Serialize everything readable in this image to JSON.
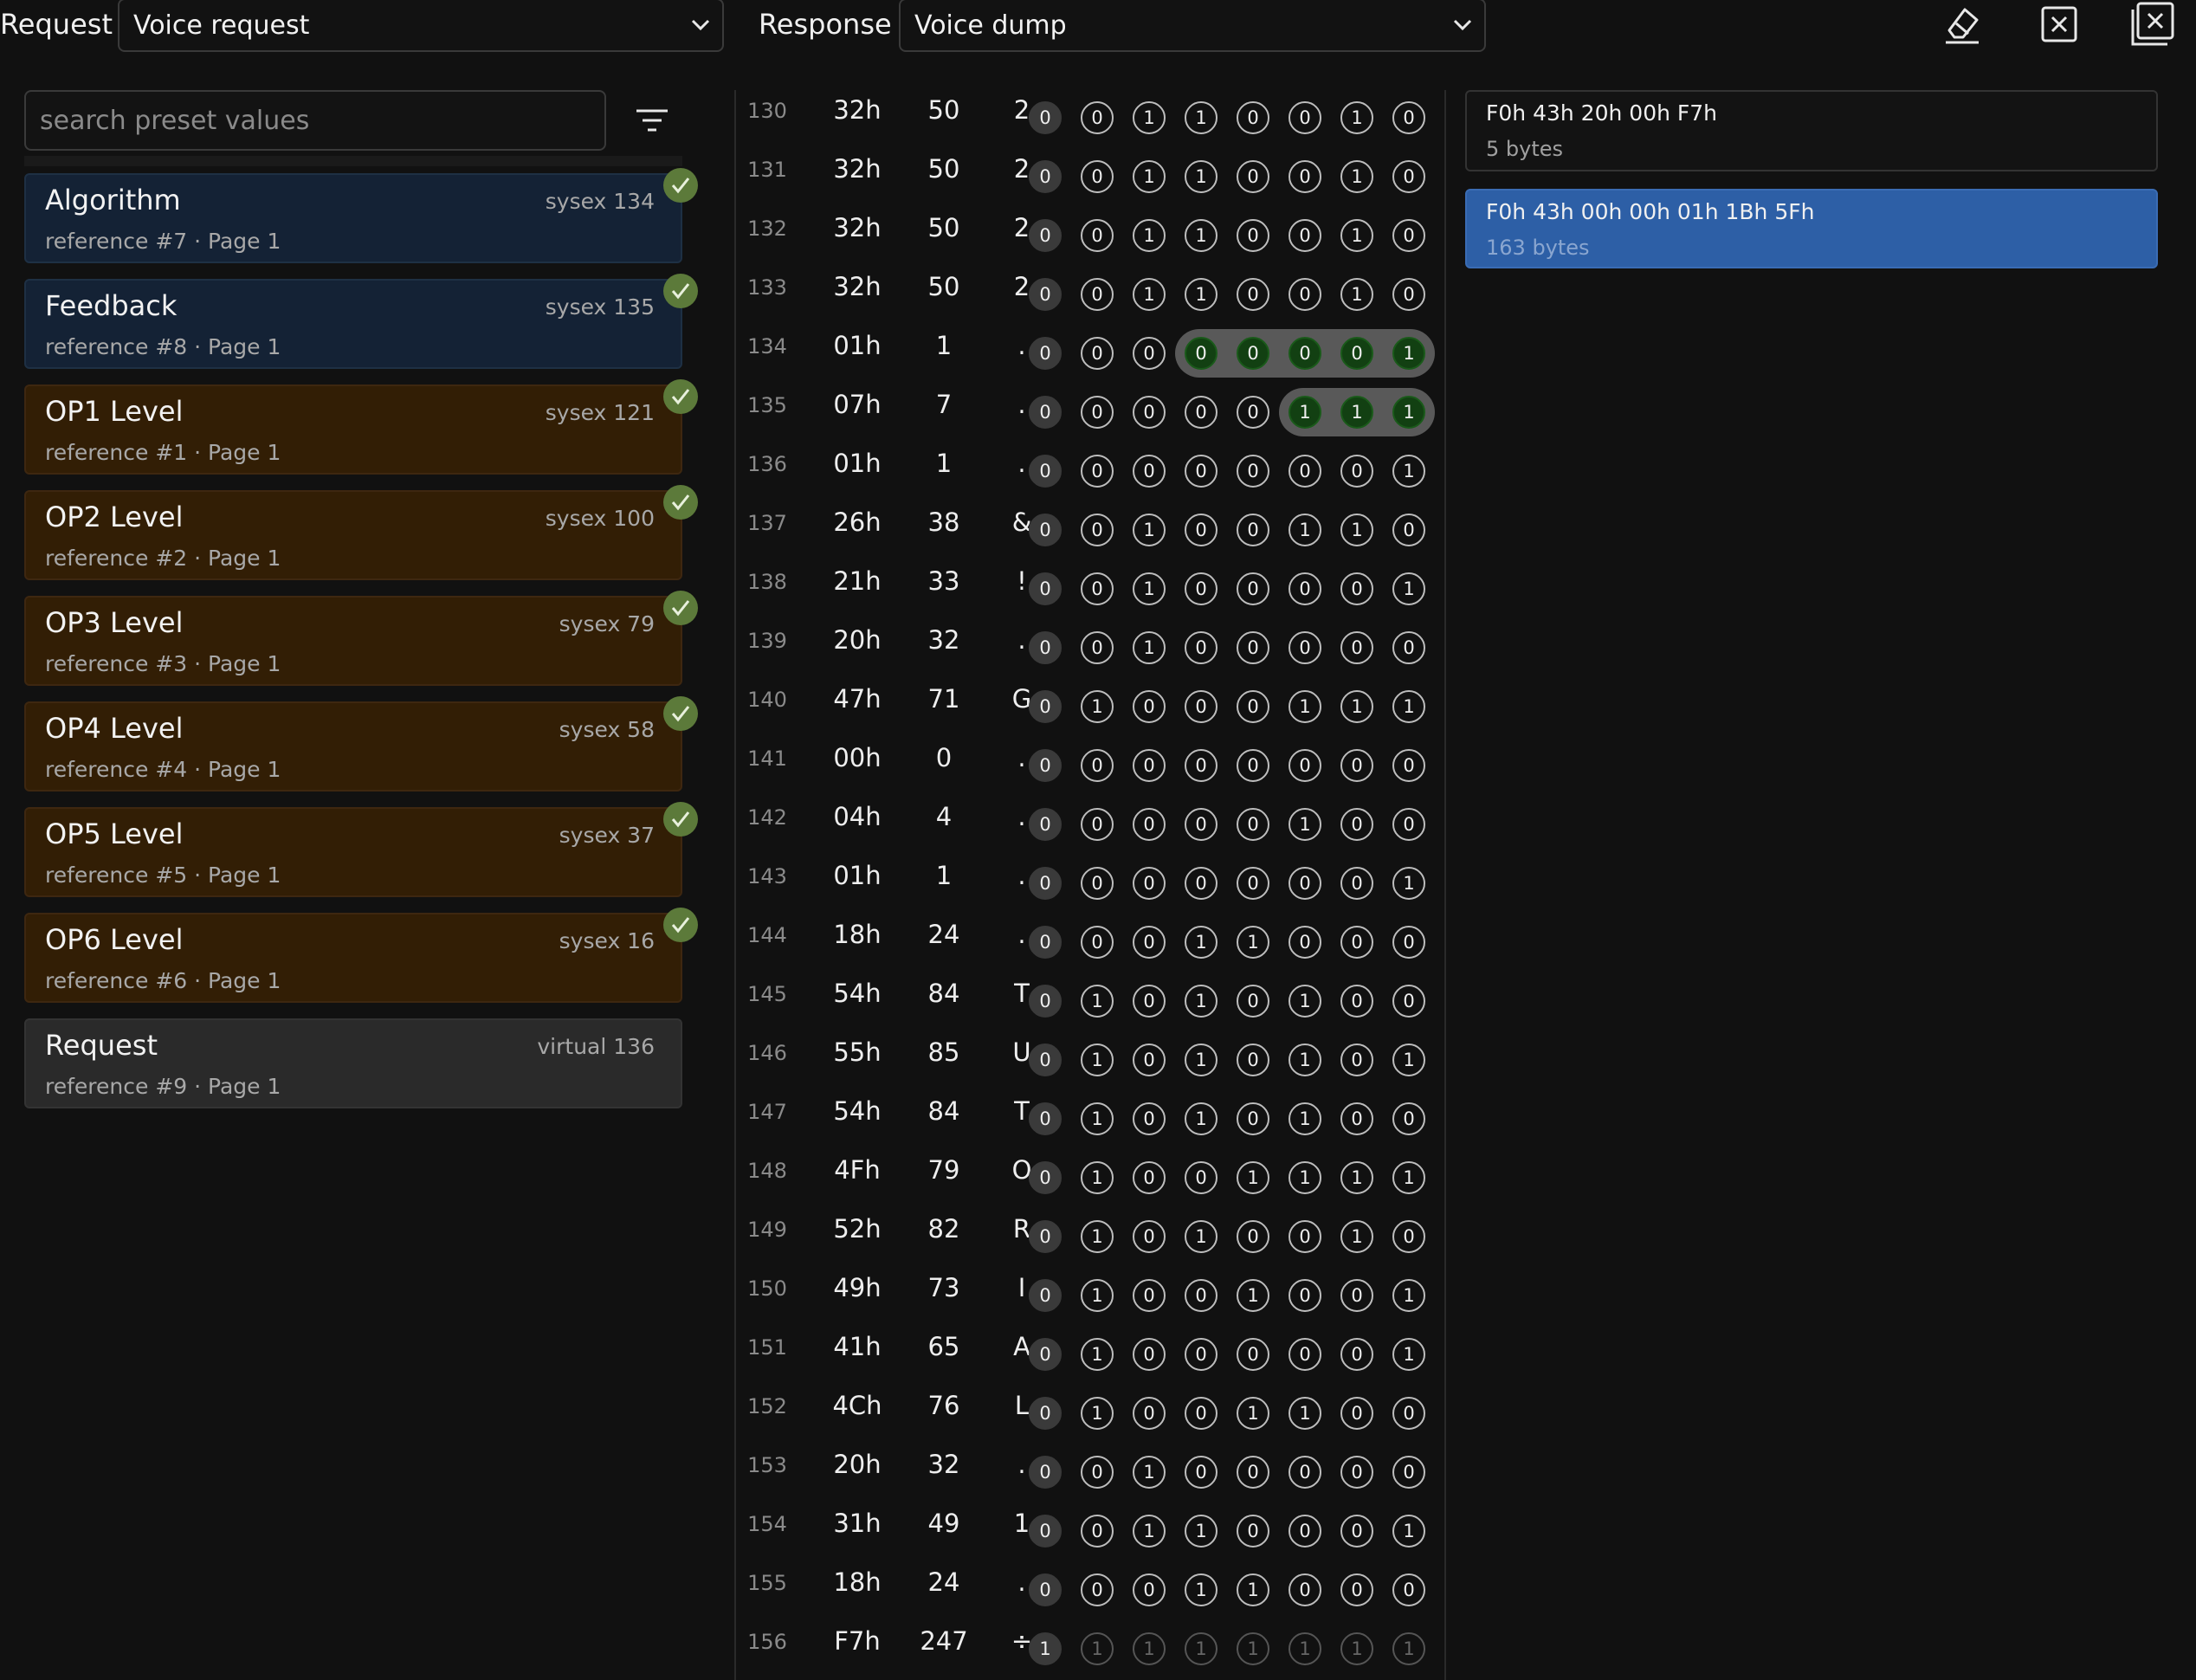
{
  "header": {
    "request_label": "Request",
    "request_value": "Voice request",
    "response_label": "Response",
    "response_value": "Voice dump"
  },
  "toolbar": {
    "icons": [
      "eraser-icon",
      "close-box-icon",
      "close-all-icon"
    ]
  },
  "search": {
    "placeholder": "search preset values",
    "value": ""
  },
  "presets": [
    {
      "name": "Algorithm",
      "ref": "reference #7 · Page 1",
      "sysex": "sysex 134",
      "color": "blue",
      "checked": true
    },
    {
      "name": "Feedback",
      "ref": "reference #8 · Page 1",
      "sysex": "sysex 135",
      "color": "blue",
      "checked": true
    },
    {
      "name": "OP1 Level",
      "ref": "reference #1 · Page 1",
      "sysex": "sysex 121",
      "color": "orange",
      "checked": true
    },
    {
      "name": "OP2 Level",
      "ref": "reference #2 · Page 1",
      "sysex": "sysex 100",
      "color": "orange",
      "checked": true
    },
    {
      "name": "OP3 Level",
      "ref": "reference #3 · Page 1",
      "sysex": "sysex 79",
      "color": "orange",
      "checked": true
    },
    {
      "name": "OP4 Level",
      "ref": "reference #4 · Page 1",
      "sysex": "sysex 58",
      "color": "orange",
      "checked": true
    },
    {
      "name": "OP5 Level",
      "ref": "reference #5 · Page 1",
      "sysex": "sysex 37",
      "color": "orange",
      "checked": true
    },
    {
      "name": "OP6 Level",
      "ref": "reference #6 · Page 1",
      "sysex": "sysex 16",
      "color": "orange",
      "checked": true
    },
    {
      "name": "Request",
      "ref": "reference #9 · Page 1",
      "sysex": "virtual 136",
      "color": "gray",
      "checked": false
    }
  ],
  "rows": [
    {
      "idx": "130",
      "hex": "32h",
      "dec": "50",
      "chr": "2",
      "bits": "00110010"
    },
    {
      "idx": "131",
      "hex": "32h",
      "dec": "50",
      "chr": "2",
      "bits": "00110010"
    },
    {
      "idx": "132",
      "hex": "32h",
      "dec": "50",
      "chr": "2",
      "bits": "00110010"
    },
    {
      "idx": "133",
      "hex": "32h",
      "dec": "50",
      "chr": "2",
      "bits": "00110010"
    },
    {
      "idx": "134",
      "hex": "01h",
      "dec": "1",
      "chr": ".",
      "bits": "00000001",
      "hl": [
        3,
        7
      ]
    },
    {
      "idx": "135",
      "hex": "07h",
      "dec": "7",
      "chr": ".",
      "bits": "00000111",
      "hl": [
        5,
        7
      ]
    },
    {
      "idx": "136",
      "hex": "01h",
      "dec": "1",
      "chr": ".",
      "bits": "00000001"
    },
    {
      "idx": "137",
      "hex": "26h",
      "dec": "38",
      "chr": "&",
      "bits": "00100110"
    },
    {
      "idx": "138",
      "hex": "21h",
      "dec": "33",
      "chr": "!",
      "bits": "00100001"
    },
    {
      "idx": "139",
      "hex": "20h",
      "dec": "32",
      "chr": ".",
      "bits": "00100000"
    },
    {
      "idx": "140",
      "hex": "47h",
      "dec": "71",
      "chr": "G",
      "bits": "01000111"
    },
    {
      "idx": "141",
      "hex": "00h",
      "dec": "0",
      "chr": ".",
      "bits": "00000000"
    },
    {
      "idx": "142",
      "hex": "04h",
      "dec": "4",
      "chr": ".",
      "bits": "00000100"
    },
    {
      "idx": "143",
      "hex": "01h",
      "dec": "1",
      "chr": ".",
      "bits": "00000001"
    },
    {
      "idx": "144",
      "hex": "18h",
      "dec": "24",
      "chr": ".",
      "bits": "00011000"
    },
    {
      "idx": "145",
      "hex": "54h",
      "dec": "84",
      "chr": "T",
      "bits": "01010100"
    },
    {
      "idx": "146",
      "hex": "55h",
      "dec": "85",
      "chr": "U",
      "bits": "01010101"
    },
    {
      "idx": "147",
      "hex": "54h",
      "dec": "84",
      "chr": "T",
      "bits": "01010100"
    },
    {
      "idx": "148",
      "hex": "4Fh",
      "dec": "79",
      "chr": "O",
      "bits": "01001111"
    },
    {
      "idx": "149",
      "hex": "52h",
      "dec": "82",
      "chr": "R",
      "bits": "01010010"
    },
    {
      "idx": "150",
      "hex": "49h",
      "dec": "73",
      "chr": "I",
      "bits": "01001001"
    },
    {
      "idx": "151",
      "hex": "41h",
      "dec": "65",
      "chr": "A",
      "bits": "01000001"
    },
    {
      "idx": "152",
      "hex": "4Ch",
      "dec": "76",
      "chr": "L",
      "bits": "01001100"
    },
    {
      "idx": "153",
      "hex": "20h",
      "dec": "32",
      "chr": ".",
      "bits": "00100000"
    },
    {
      "idx": "154",
      "hex": "31h",
      "dec": "49",
      "chr": "1",
      "bits": "00110001"
    },
    {
      "idx": "155",
      "hex": "18h",
      "dec": "24",
      "chr": ".",
      "bits": "00011000"
    },
    {
      "idx": "156",
      "hex": "F7h",
      "dec": "247",
      "chr": "÷",
      "bits": "11111111",
      "dim": true
    }
  ],
  "messages": [
    {
      "title": "F0h 43h 20h 00h F7h",
      "bytes": "5 bytes",
      "selected": false
    },
    {
      "title": "F0h 43h 00h 00h 01h 1Bh 5Fh",
      "bytes": "163 bytes",
      "selected": true
    }
  ],
  "colors": {
    "background": "#111111",
    "preset_blue": "#142235",
    "preset_orange": "#321e05",
    "preset_gray": "#2a2a2a",
    "check_green": "#5c7a3a",
    "bit_highlight": "#124012",
    "selected_message": "#2d5fa6"
  }
}
